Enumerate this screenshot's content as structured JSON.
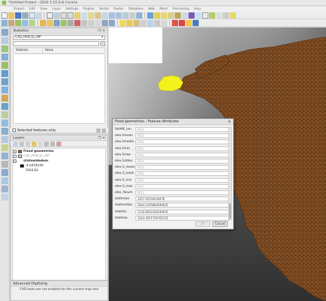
{
  "window": {
    "title": "*Untitled Project - QGIS 3.10.0-A Coruña"
  },
  "menubar": {
    "items": [
      "Project",
      "Edit",
      "View",
      "Layer",
      "Settings",
      "Plugins",
      "Vector",
      "Raster",
      "Database",
      "Web",
      "Mesh",
      "Processing",
      "Help"
    ]
  },
  "colors": {
    "selection_yellow": "#f5f11d",
    "raster_feature_brown": "#7a4820",
    "accent_blue": "#2b6cc4"
  },
  "statistics_panel": {
    "title": "Statistics",
    "layer_combo_value": "CAD_PARCEL_MP",
    "columns": [
      "Statistic",
      "Value"
    ]
  },
  "selected_features_only": {
    "label": "Selected features only"
  },
  "layers_panel": {
    "title": "Layers",
    "items": [
      {
        "name": "Fixed geometries",
        "style": "bold",
        "checked": true,
        "swatch": "#7a5a4a"
      },
      {
        "name": "CAD_PARCEL_MP",
        "style": "grey",
        "checked": false,
        "swatch": "#c8c8c8"
      },
      {
        "name": "statewidedem",
        "style": "bold",
        "checked": true,
        "swatch": ""
      },
      {
        "name": "-0.0459199",
        "style": "normal",
        "checked": false,
        "swatch": "#000000"
      },
      {
        "name": "3564.83",
        "style": "normal",
        "checked": false,
        "swatch": ""
      }
    ]
  },
  "advanced_digitizing": {
    "title": "Advanced Digitizing",
    "message": "CAD tools are not enabled for the current map tool"
  },
  "feature_dialog": {
    "title": "Fixed geometries - Feature Attributes",
    "fields": [
      {
        "label": "SHAPE_len",
        "value": "NULL",
        "null": true
      },
      {
        "label": "elev.1mean",
        "value": "NULL",
        "null": true
      },
      {
        "label": "elev.1media",
        "value": "NULL",
        "null": true
      },
      {
        "label": "elev.1min",
        "value": "NULL",
        "null": true
      },
      {
        "label": "elev.1max",
        "value": "NULL",
        "null": true
      },
      {
        "label": "elev.1stdev",
        "value": "NULL",
        "null": true
      },
      {
        "label": "elev-2_mean",
        "value": "NULL",
        "null": true
      },
      {
        "label": "elev-2_medi",
        "value": "NULL",
        "null": true
      },
      {
        "label": "elev-2_min",
        "value": "NULL",
        "null": true
      },
      {
        "label": "elev-2_max",
        "value": "NULL",
        "null": true
      },
      {
        "label": "elev_%sum",
        "value": "NULL",
        "null": true
      },
      {
        "label": "statmean",
        "value": "2457.03530434678",
        "null": false
      },
      {
        "label": "statmedian",
        "value": "2644.1455884590625",
        "null": false
      },
      {
        "label": "statmin",
        "value": "1120.0651560190625",
        "null": false
      },
      {
        "label": "statmax",
        "value": "3324.3051759765125",
        "null": false
      }
    ],
    "ok_label": "OK",
    "cancel_label": "Cancel"
  }
}
